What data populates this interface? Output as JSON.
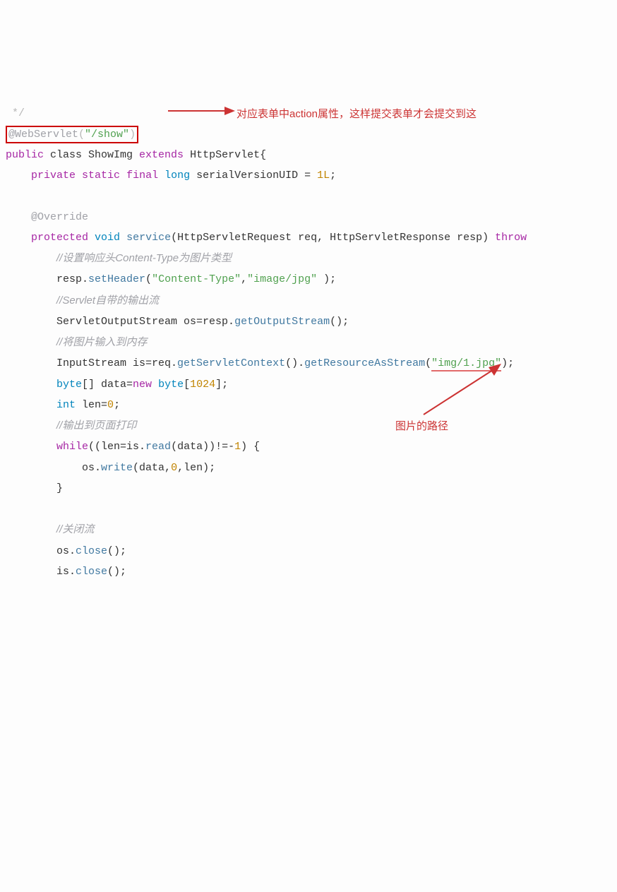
{
  "note_top": "对应表单中action属性，这样提交表单才会提交到这",
  "note_mid": "图片的路径",
  "code": {
    "c0": " */",
    "ann_at": "@WebServlet",
    "ann_p1": "(",
    "ann_str": "\"/show\"",
    "ann_p2": ")",
    "l2_a": "public",
    "l2_b": " class ",
    "l2_c": "ShowImg ",
    "l2_d": "extends",
    "l2_e": " HttpServlet{",
    "l3_a": "    ",
    "l3_b": "private",
    "l3_c": " ",
    "l3_d": "static",
    "l3_e": " ",
    "l3_f": "final",
    "l3_g": " ",
    "l3_h": "long",
    "l3_i": " serialVersionUID = ",
    "l3_j": "1L",
    "l3_k": ";",
    "l5_a": "    ",
    "l5_b": "@Override",
    "l6_a": "    ",
    "l6_b": "protected",
    "l6_c": " ",
    "l6_d": "void",
    "l6_e": " ",
    "l6_f": "service",
    "l6_g": "(HttpServletRequest req, HttpServletResponse resp) ",
    "l6_h": "throw",
    "l7_a": "        ",
    "l7_b": "//设置响应头Content-Type为图片类型",
    "l8_a": "        resp.",
    "l8_b": "setHeader",
    "l8_c": "(",
    "l8_d": "\"Content-Type\"",
    "l8_e": ",",
    "l8_f": "\"image/jpg\"",
    "l8_g": " );",
    "l9_a": "        ",
    "l9_b": "//Servlet自带的输出流",
    "l10_a": "        ServletOutputStream os=resp.",
    "l10_b": "getOutputStream",
    "l10_c": "();",
    "l11_a": "        ",
    "l11_b": "//将图片输入到内存",
    "l12_a": "        InputStream is=req.",
    "l12_b": "getServletContext",
    "l12_c": "().",
    "l12_d": "getResourceAsStream",
    "l12_e": "(",
    "l12_f": "\"img/1.jpg\"",
    "l12_g": ");",
    "l13_a": "        ",
    "l13_b": "byte",
    "l13_c": "[] data=",
    "l13_d": "new",
    "l13_e": " ",
    "l13_f": "byte",
    "l13_g": "[",
    "l13_h": "1024",
    "l13_i": "];",
    "l14_a": "        ",
    "l14_b": "int",
    "l14_c": " len=",
    "l14_d": "0",
    "l14_e": ";",
    "l15_a": "        ",
    "l15_b": "//输出到页面打印",
    "l16_a": "        ",
    "l16_b": "while",
    "l16_c": "((len=is.",
    "l16_d": "read",
    "l16_e": "(data))!=-",
    "l16_f": "1",
    "l16_g": ") {",
    "l17_a": "            os.",
    "l17_b": "write",
    "l17_c": "(data,",
    "l17_d": "0",
    "l17_e": ",len);",
    "l18_a": "        }",
    "l20_a": "        ",
    "l20_b": "//关闭流",
    "l21_a": "        os.",
    "l21_b": "close",
    "l21_c": "();",
    "l22_a": "        is.",
    "l22_b": "close",
    "l22_c": "();"
  }
}
